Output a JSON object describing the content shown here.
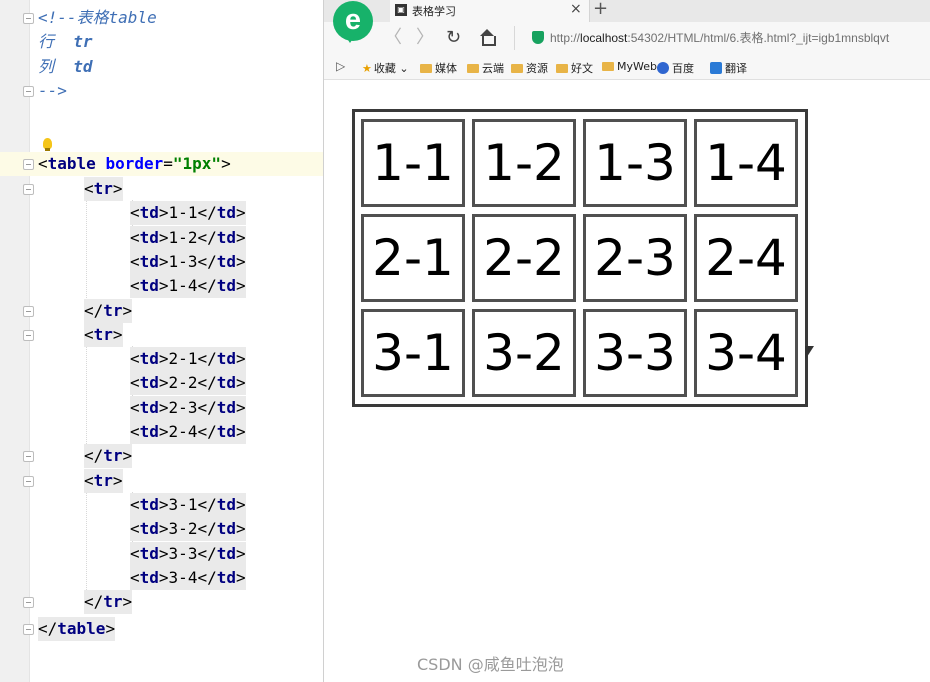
{
  "editor": {
    "comment": {
      "open": "<!--表格table",
      "row_word": "行",
      "row_tag": "tr",
      "col_word": "列",
      "col_tag": "td",
      "close": "-->"
    },
    "table_open": {
      "bracket_open": "<",
      "tag": "table",
      "attr": "border",
      "eq": "=",
      "value": "\"1px\"",
      "bracket_close": ">"
    },
    "rows": [
      {
        "cells": [
          "1-1",
          "1-2",
          "1-3",
          "1-4"
        ]
      },
      {
        "cells": [
          "2-1",
          "2-2",
          "2-3",
          "2-4"
        ]
      },
      {
        "cells": [
          "3-1",
          "3-2",
          "3-3",
          "3-4"
        ]
      }
    ],
    "tags": {
      "tr": "tr",
      "td": "td",
      "table": "table"
    }
  },
  "browser": {
    "logo_letter": "e",
    "tab": {
      "title": "表格学习",
      "close": "×"
    },
    "new_tab": "+",
    "nav": {
      "back": "〈",
      "forward": "〉",
      "reload": "↻"
    },
    "url": {
      "scheme": "http://",
      "host": "localhost",
      "rest": ":54302/HTML/html/6.表格.html?_ijt=igb1mnsblqvt"
    },
    "bookmarks_toggle": "▷",
    "bookmarks": [
      {
        "label": "收藏",
        "type": "star",
        "suffix": "⌄"
      },
      {
        "label": "媒体",
        "type": "folder"
      },
      {
        "label": "云端",
        "type": "folder"
      },
      {
        "label": "资源",
        "type": "folder"
      },
      {
        "label": "好文",
        "type": "folder"
      },
      {
        "label": "MyWeb",
        "type": "folder"
      },
      {
        "label": "百度",
        "type": "baidu"
      },
      {
        "label": "翻译",
        "type": "translate"
      }
    ],
    "table_cells": [
      [
        "1-1",
        "1-2",
        "1-3",
        "1-4"
      ],
      [
        "2-1",
        "2-2",
        "2-3",
        "2-4"
      ],
      [
        "3-1",
        "3-2",
        "3-3",
        "3-4"
      ]
    ]
  },
  "watermark": "CSDN @咸鱼吐泡泡",
  "colors": {
    "comment": "#3f6fb5",
    "tag": "#000080",
    "attribute": "#0000ff",
    "attr_value": "#008000",
    "logo": "#17b26a"
  }
}
